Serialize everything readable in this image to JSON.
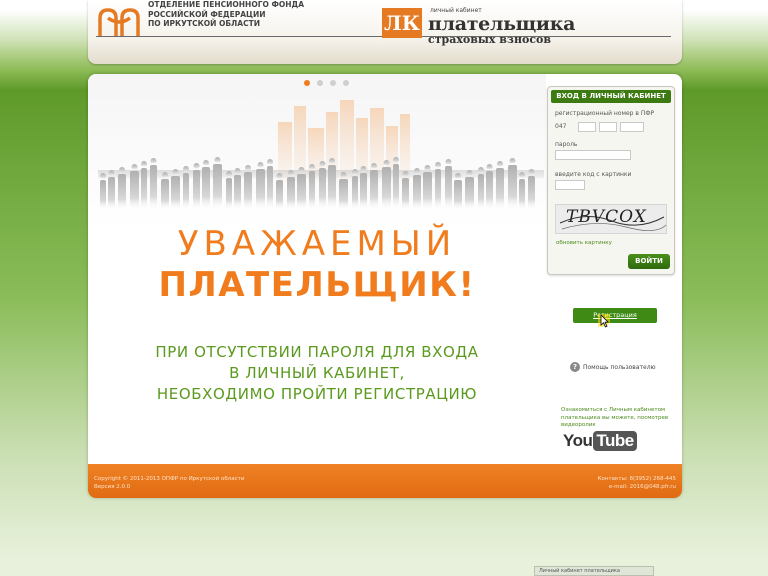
{
  "header": {
    "pfr_lines": [
      "Отделение Пенсионного Фонда",
      "Российской Федерации",
      "по Иркутской области"
    ],
    "lk_badge": "ЛК",
    "lk_small": "личный кабинет",
    "lk_title": "плательщика",
    "lk_subtitle": "страховых взносов"
  },
  "hero": {
    "title_line1": "УВАЖАЕМЫЙ",
    "title_line2": "ПЛАТЕЛЬЩИК!",
    "message_lines": [
      "ПРИ ОТСУТСТВИИ ПАРОЛЯ ДЛЯ ВХОДА",
      "В ЛИЧНЫЙ КАБИНЕТ,",
      "НЕОБХОДИМО ПРОЙТИ РЕГИСТРАЦИЮ"
    ],
    "slides": 4,
    "active_slide": 0
  },
  "login": {
    "header": "ВХОД В ЛИЧНЫЙ КАБИНЕТ",
    "reg_number_label": "регистрационный номер в ПФР",
    "reg_prefix": "047",
    "password_label": "пароль",
    "captcha_label": "введите код с картинки",
    "captcha_text": "TBVCOX",
    "refresh_link": "обновить картинку",
    "submit_label": "ВОЙТИ"
  },
  "sidebar": {
    "register_label": "Регистрация",
    "help_label": "Помощь пользователю",
    "youtube_text": "Ознакомиться с Личным кабинетом плательщика вы можете, посмотрев видеоролик",
    "youtube_you": "You",
    "youtube_tube": "Tube"
  },
  "footer": {
    "left_lines": [
      "Copyright © 2011-2013 ОПФР по Иркутской области",
      "Версия 2.0.0"
    ],
    "right_lines": [
      "Контакты: 8(3952) 268-445",
      "e-mail: 2016@048.pfr.ru"
    ]
  },
  "taskbar": {
    "label": "Личный кабинет плательщика"
  },
  "colors": {
    "accent_orange": "#f07c1e",
    "accent_green": "#3d7a12",
    "message_green": "#5a9a1e"
  }
}
